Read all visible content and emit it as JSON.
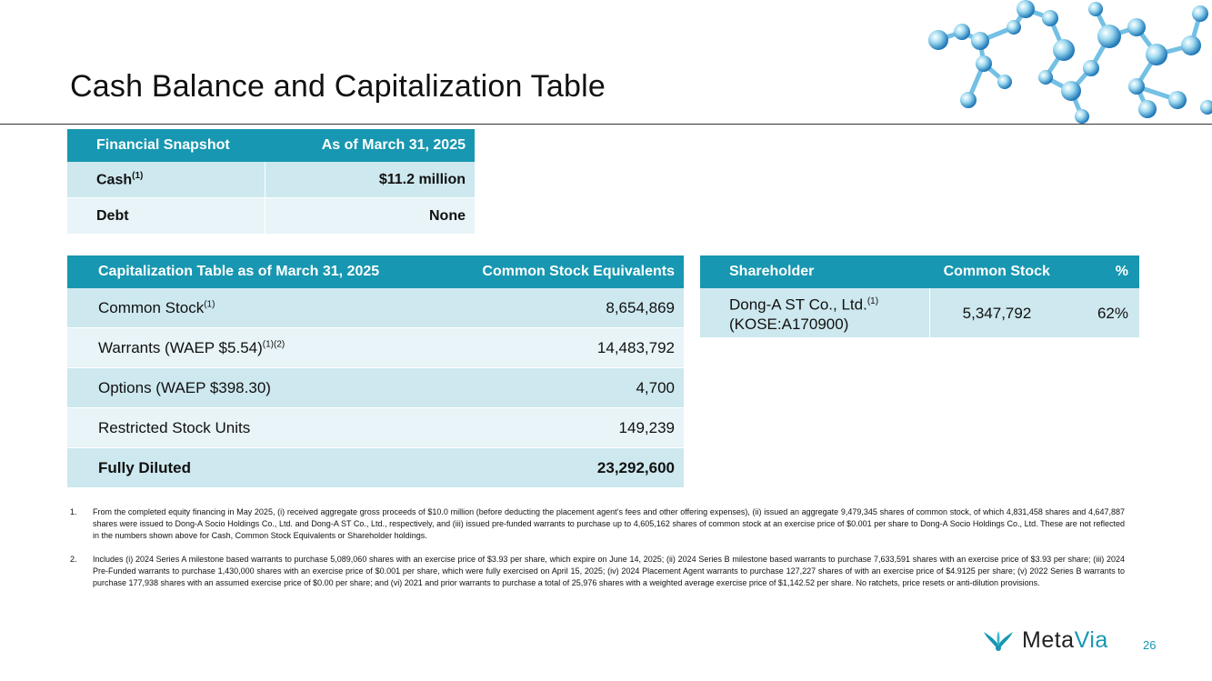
{
  "title": "Cash Balance and Capitalization Table",
  "snapshot": {
    "headers": [
      "Financial Snapshot",
      "As of March 31, 2025"
    ],
    "rows": [
      {
        "label": "Cash",
        "sup": "(1)",
        "value": "$11.2 million"
      },
      {
        "label": "Debt",
        "sup": "",
        "value": "None"
      }
    ]
  },
  "captable": {
    "headers": [
      "Capitalization Table as of March 31, 2025",
      "Common Stock Equivalents"
    ],
    "rows": [
      {
        "label": "Common Stock",
        "sup": "(1)",
        "value": "8,654,869"
      },
      {
        "label": "Warrants (WAEP $5.54)",
        "sup": "(1)(2)",
        "value": "14,483,792"
      },
      {
        "label": "Options (WAEP $398.30)",
        "sup": "",
        "value": "4,700"
      },
      {
        "label": "Restricted Stock Units",
        "sup": "",
        "value": "149,239"
      },
      {
        "label": "Fully Diluted",
        "sup": "",
        "value": "23,292,600"
      }
    ]
  },
  "shareholders": {
    "headers": [
      "Shareholder",
      "Common Stock",
      "%"
    ],
    "rows": [
      {
        "name": "Dong-A ST Co., Ltd.",
        "sup": "(1)",
        "ticker": "(KOSE:A170900)",
        "shares": "5,347,792",
        "pct": "62%"
      }
    ]
  },
  "footnotes": [
    {
      "num": "1.",
      "text": "From the completed equity financing in May 2025, (i) received aggregate gross proceeds of $10.0 million (before deducting the placement agent’s fees and other offering expenses), (ii) issued an aggregate 9,479,345 shares of common stock, of which 4,831,458 shares and 4,647,887 shares were issued to Dong-A Socio Holdings Co., Ltd. and Dong-A ST Co., Ltd., respectively, and (iii) issued pre-funded warrants to purchase up to 4,605,162 shares of common stock at an exercise price of $0.001 per share to Dong-A Socio Holdings Co., Ltd. These are not reflected in the numbers shown above for Cash, Common Stock Equivalents or Shareholder holdings."
    },
    {
      "num": "2.",
      "text": "Includes (i) 2024 Series A milestone based warrants to purchase 5,089,060 shares with an exercise price of $3.93 per share, which expire on June 14, 2025; (ii) 2024 Series B milestone based warrants to purchase 7,633,591 shares with an exercise price of $3.93 per share; (iii) 2024 Pre-Funded warrants to purchase 1,430,000 shares with an exercise price of $0.001 per share, which were fully exercised on April 15, 2025; (iv) 2024 Placement Agent warrants to purchase 127,227 shares of with an exercise price of $4.9125 per share; (v) 2022 Series B warrants to purchase 177,938 shares with an assumed exercise price of $0.00 per share; and (vi) 2021 and prior warrants to purchase a total of 25,976 shares with a weighted average exercise price of $1,142.52 per share. No ratchets, price resets or anti-dilution provisions."
    }
  ],
  "logo": {
    "meta": "Meta",
    "via": "Via"
  },
  "page_number": "26",
  "colors": {
    "header": "#1797b1",
    "row_dark": "#cde8ee",
    "row_light": "#e8f4f7"
  },
  "decoration": "molecule-graphic"
}
